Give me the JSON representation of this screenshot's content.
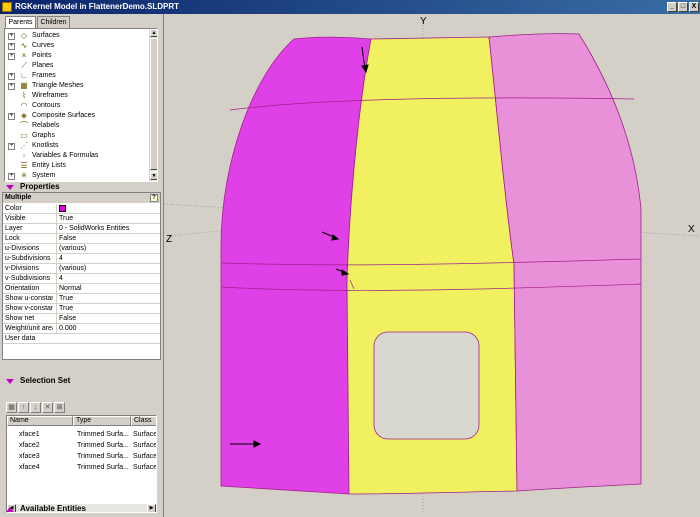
{
  "window": {
    "title": "RGKernel Model in FlattenerDemo.SLDPRT",
    "min_glyph": "_",
    "max_glyph": "□",
    "close_glyph": "X"
  },
  "tabs": [
    {
      "label": "Parents"
    },
    {
      "label": "Children"
    }
  ],
  "tree": {
    "items": [
      {
        "label": "Surfaces",
        "icon": "surfaces-icon",
        "glyph": "◇",
        "expand": "+"
      },
      {
        "label": "Curves",
        "icon": "curves-icon",
        "glyph": "∿",
        "expand": "+"
      },
      {
        "label": "Points",
        "icon": "points-icon",
        "glyph": "×",
        "expand": "+"
      },
      {
        "label": "Planes",
        "icon": "planes-icon",
        "glyph": "⟋",
        "expand": ""
      },
      {
        "label": "Frames",
        "icon": "frames-icon",
        "glyph": "∟",
        "expand": "+"
      },
      {
        "label": "Triangle Meshes",
        "icon": "triangle-mesh-icon",
        "glyph": "▦",
        "expand": "+"
      },
      {
        "label": "Wireframes",
        "icon": "wireframes-icon",
        "glyph": "⌇",
        "expand": ""
      },
      {
        "label": "Contours",
        "icon": "contours-icon",
        "glyph": "◠",
        "expand": ""
      },
      {
        "label": "Composite Surfaces",
        "icon": "composite-surfaces-icon",
        "glyph": "◈",
        "expand": "+"
      },
      {
        "label": "Relabels",
        "icon": "relabels-icon",
        "glyph": "⌒",
        "expand": ""
      },
      {
        "label": "Graphs",
        "icon": "graphs-icon",
        "glyph": "▭",
        "expand": ""
      },
      {
        "label": "Knotlists",
        "icon": "knotlists-icon",
        "glyph": "⋰",
        "expand": "+"
      },
      {
        "label": "Variables & Formulas",
        "icon": "variables-icon",
        "glyph": "◦",
        "expand": ""
      },
      {
        "label": "Entity Lists",
        "icon": "entity-lists-icon",
        "glyph": "☰",
        "expand": ""
      },
      {
        "label": "System",
        "icon": "system-icon",
        "glyph": "✳",
        "expand": "+"
      }
    ]
  },
  "properties": {
    "header": "Properties",
    "group": "Multiple",
    "help_glyph": "?",
    "color_value": "#e000e0",
    "rows": [
      {
        "name": "Color",
        "value": ""
      },
      {
        "name": "Visible",
        "value": "True"
      },
      {
        "name": "Layer",
        "value": "0 - SolidWorks Entities"
      },
      {
        "name": "Lock",
        "value": "False"
      },
      {
        "name": "u-Divisions",
        "value": "(various)"
      },
      {
        "name": "u-Subdivisions",
        "value": "4"
      },
      {
        "name": "v-Divisions",
        "value": "(various)"
      },
      {
        "name": "v-Subdivisions",
        "value": "4"
      },
      {
        "name": "Orientation",
        "value": "Normal"
      },
      {
        "name": "Show u-constant",
        "value": "True"
      },
      {
        "name": "Show v-constant",
        "value": "True"
      },
      {
        "name": "Show net",
        "value": "False"
      },
      {
        "name": "Weight/unit area",
        "value": "0.000"
      },
      {
        "name": "User data",
        "value": ""
      }
    ]
  },
  "selection_set": {
    "header": "Selection Set",
    "toolbar": [
      {
        "name": "select-all-icon",
        "glyph": "▦"
      },
      {
        "name": "move-up-icon",
        "glyph": "↑"
      },
      {
        "name": "move-down-icon",
        "glyph": "↓"
      },
      {
        "name": "remove-icon",
        "glyph": "✕"
      },
      {
        "name": "clear-icon",
        "glyph": "⊠"
      }
    ],
    "columns": [
      "Name",
      "Type",
      "Class"
    ],
    "rows": [
      {
        "name": "xface1",
        "type": "Trimmed Surfa...",
        "class": "Surface"
      },
      {
        "name": "xface2",
        "type": "Trimmed Surfa...",
        "class": "Surface"
      },
      {
        "name": "xface3",
        "type": "Trimmed Surfa...",
        "class": "Surface"
      },
      {
        "name": "xface4",
        "type": "Trimmed Surfa...",
        "class": "Surface"
      }
    ]
  },
  "available_entities": {
    "header": "Available Entities"
  },
  "viewport": {
    "axis_x": "X",
    "axis_y": "Y",
    "axis_z": "Z",
    "colors": {
      "magenta": "#e040e8",
      "yellow": "#f0f060",
      "pink": "#e890d8",
      "hole": "#d8d8d0",
      "background": "#d4d0c8",
      "edge": "#a0208a"
    }
  }
}
